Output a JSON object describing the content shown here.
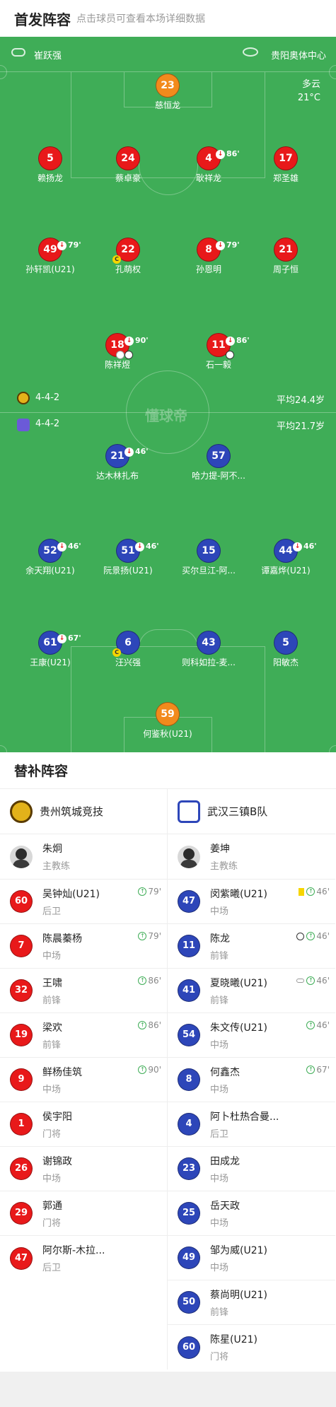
{
  "header": {
    "title": "首发阵容",
    "subtitle": "点击球员可查看本场详细数据"
  },
  "pitch": {
    "home_coach": "崔跃强",
    "venue": "贵阳奥体中心",
    "weather": "多云",
    "temperature": "21°C",
    "home_formation": "4-4-2",
    "home_avg_age": "平均24.4岁",
    "away_formation": "4-4-2",
    "away_avg_age": "平均21.7岁",
    "watermark": "懂球帝"
  },
  "home_players": [
    {
      "num": "23",
      "name": "慈恒龙",
      "color": "orange"
    },
    {
      "num": "5",
      "name": "赖扬龙",
      "color": "red"
    },
    {
      "num": "24",
      "name": "蔡卓豪",
      "color": "red"
    },
    {
      "num": "4",
      "name": "耿祥龙",
      "color": "red",
      "sub": "86'"
    },
    {
      "num": "17",
      "name": "郑圣雄",
      "color": "red"
    },
    {
      "num": "49",
      "name": "孙轩凯(U21)",
      "color": "red",
      "sub": "79'"
    },
    {
      "num": "22",
      "name": "孔萌权",
      "color": "red",
      "card": "C"
    },
    {
      "num": "8",
      "name": "孙恩明",
      "color": "red",
      "sub": "79'"
    },
    {
      "num": "21",
      "name": "周子恒",
      "color": "red"
    },
    {
      "num": "18",
      "name": "陈祥煜",
      "color": "red",
      "sub": "90'"
    },
    {
      "num": "11",
      "name": "石一毅",
      "color": "red",
      "sub": "86'"
    }
  ],
  "away_players": [
    {
      "num": "21",
      "name": "达木林扎布",
      "color": "blue",
      "sub": "46'"
    },
    {
      "num": "57",
      "name": "哈力提-阿不...",
      "color": "blue"
    },
    {
      "num": "52",
      "name": "余天翔(U21)",
      "color": "blue",
      "sub": "46'"
    },
    {
      "num": "51",
      "name": "阮景扬(U21)",
      "color": "blue",
      "sub": "46'"
    },
    {
      "num": "15",
      "name": "买尔旦江-阿...",
      "color": "blue"
    },
    {
      "num": "44",
      "name": "谭嘉烨(U21)",
      "color": "blue",
      "sub": "46'"
    },
    {
      "num": "61",
      "name": "王康(U21)",
      "color": "blue",
      "sub": "67'"
    },
    {
      "num": "6",
      "name": "汪兴强",
      "color": "blue",
      "card": "C"
    },
    {
      "num": "43",
      "name": "则科如拉-麦...",
      "color": "blue"
    },
    {
      "num": "5",
      "name": "阳敏杰",
      "color": "blue"
    },
    {
      "num": "59",
      "name": "何鉴秋(U21)",
      "color": "orange"
    }
  ],
  "bench": {
    "title": "替补阵容",
    "home": {
      "team": "贵州筑城竞技",
      "coach_name": "朱炯",
      "coach_role": "主教练",
      "subs": [
        {
          "num": "60",
          "name": "吴钟灿(U21)",
          "pos": "后卫",
          "ev": "79'"
        },
        {
          "num": "7",
          "name": "陈晨蓁杨",
          "pos": "中场",
          "ev": "79'"
        },
        {
          "num": "32",
          "name": "王啸",
          "pos": "前锋",
          "ev": "86'"
        },
        {
          "num": "19",
          "name": "梁欢",
          "pos": "前锋",
          "ev": "86'"
        },
        {
          "num": "9",
          "name": "鲜杨佳筑",
          "pos": "中场",
          "ev": "90'"
        },
        {
          "num": "1",
          "name": "侯宇阳",
          "pos": "门将",
          "ev": ""
        },
        {
          "num": "26",
          "name": "谢锦政",
          "pos": "中场",
          "ev": ""
        },
        {
          "num": "29",
          "name": "郭通",
          "pos": "门将",
          "ev": ""
        },
        {
          "num": "47",
          "name": "阿尔斯-木拉...",
          "pos": "后卫",
          "ev": ""
        }
      ]
    },
    "away": {
      "team": "武汉三镇B队",
      "coach_name": "姜坤",
      "coach_role": "主教练",
      "subs": [
        {
          "num": "47",
          "name": "闵紫曦(U21)",
          "pos": "中场",
          "ev": "46'"
        },
        {
          "num": "11",
          "name": "陈龙",
          "pos": "前锋",
          "ev": "46'"
        },
        {
          "num": "41",
          "name": "夏晓曦(U21)",
          "pos": "前锋",
          "ev": "46'"
        },
        {
          "num": "54",
          "name": "朱文传(U21)",
          "pos": "中场",
          "ev": "46'"
        },
        {
          "num": "8",
          "name": "何鑫杰",
          "pos": "中场",
          "ev": "67'"
        },
        {
          "num": "4",
          "name": "阿卜杜热合曼...",
          "pos": "后卫",
          "ev": ""
        },
        {
          "num": "23",
          "name": "田成龙",
          "pos": "中场",
          "ev": ""
        },
        {
          "num": "25",
          "name": "岳天政",
          "pos": "中场",
          "ev": ""
        },
        {
          "num": "49",
          "name": "邹为威(U21)",
          "pos": "中场",
          "ev": ""
        },
        {
          "num": "50",
          "name": "蔡尚明(U21)",
          "pos": "前锋",
          "ev": ""
        },
        {
          "num": "60",
          "name": "陈星(U21)",
          "pos": "门将",
          "ev": ""
        }
      ]
    }
  },
  "colors": {
    "pitch": "#3fad57",
    "home": "#e8191a",
    "away": "#2d46b9",
    "keeper": "#f28a1c"
  }
}
